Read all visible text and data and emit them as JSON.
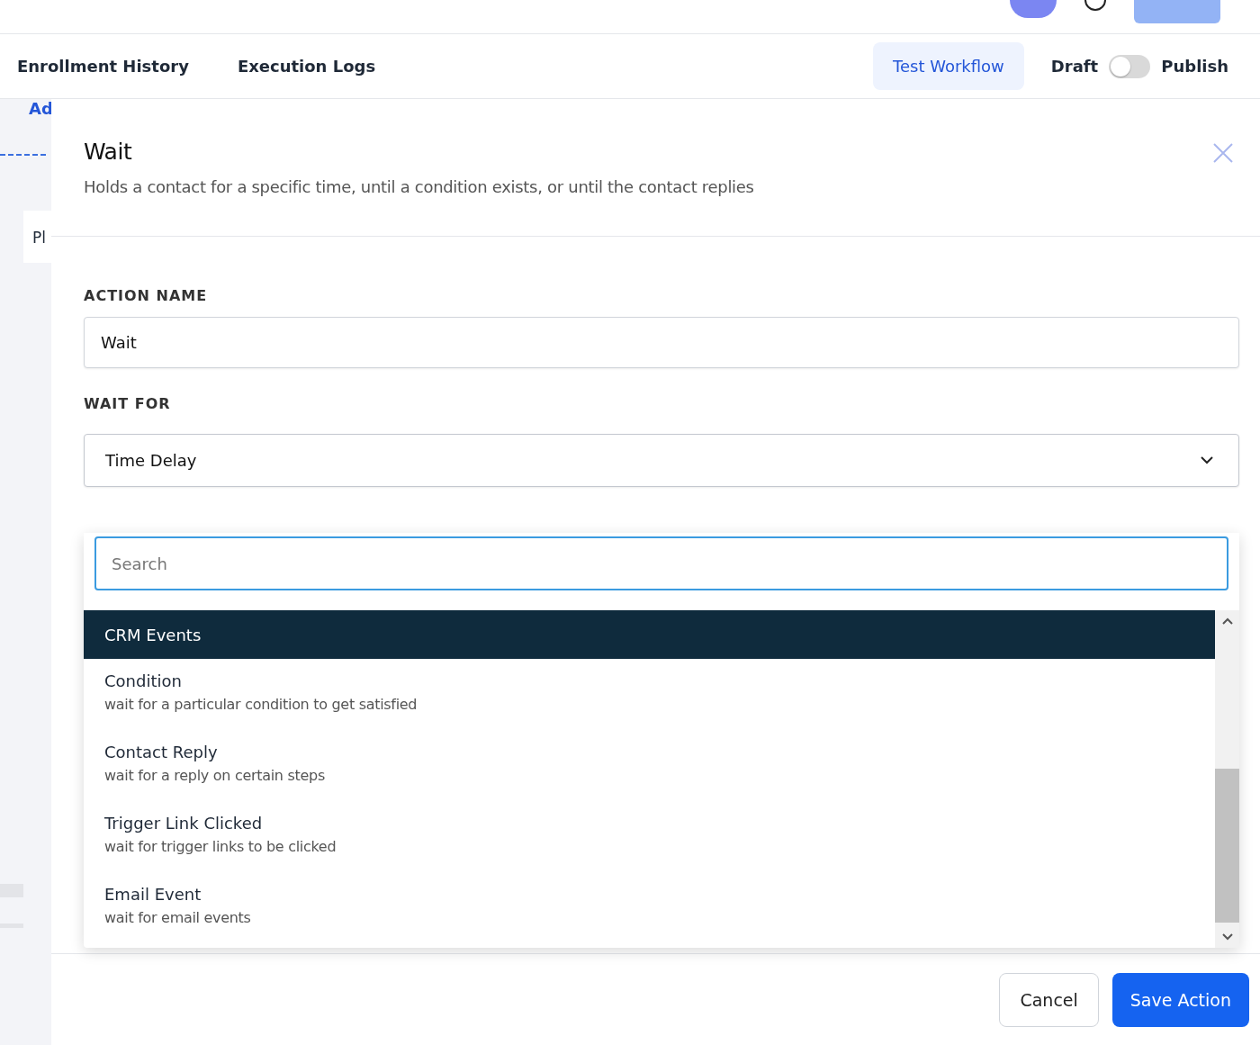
{
  "tabs": [
    {
      "label": "Enrollment History"
    },
    {
      "label": "Execution Logs"
    }
  ],
  "test_button": "Test Workflow",
  "publish_toggle": {
    "off_label": "Draft",
    "on_label": "Publish",
    "on": false
  },
  "canvas": {
    "link_text": "Ad",
    "node_text": "Pl"
  },
  "panel": {
    "title": "Wait",
    "description": "Holds a contact for a specific time, until a condition exists, or until the contact replies",
    "action_name": {
      "label": "ACTION NAME",
      "value": "Wait"
    },
    "wait_for": {
      "label": "WAIT FOR",
      "value": "Time Delay",
      "expanded": true,
      "search": {
        "placeholder": "Search"
      },
      "options": [
        {
          "label": "CRM Events",
          "highlighted": true
        },
        {
          "label": "Condition",
          "description": "wait for a particular condition to get satisfied",
          "highlighted": false
        },
        {
          "label": "Contact Reply",
          "description": "wait for a reply on certain steps",
          "highlighted": false
        },
        {
          "label": "Trigger Link Clicked",
          "description": "wait for trigger links to be clicked",
          "highlighted": false
        },
        {
          "label": "Email Event",
          "description": "wait for email events",
          "highlighted": false
        }
      ]
    }
  },
  "footer": {
    "cancel": "Cancel",
    "save": "Save Action"
  }
}
